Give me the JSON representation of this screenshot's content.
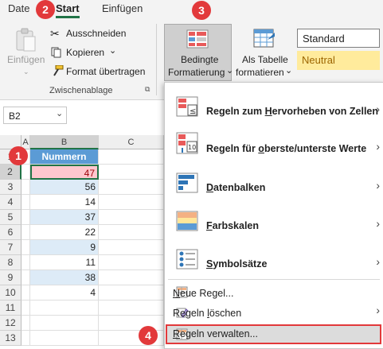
{
  "ribbon": {
    "tabs": [
      "Date",
      "Start",
      "Einfügen"
    ],
    "active_tab": "Start",
    "clipboard": {
      "paste_label": "Einfügen",
      "cut_label": "Ausschneiden",
      "copy_label": "Kopieren",
      "format_painter_label": "Format übertragen",
      "group_label": "Zwischenablage"
    },
    "conditional_formatting": {
      "line1": "Bedingte",
      "line2": "Formatierung"
    },
    "format_as_table": {
      "line1": "Als Tabelle",
      "line2": "formatieren"
    },
    "styles": [
      {
        "label": "Standard",
        "bg": "#ffffff"
      },
      {
        "label": "Neutral",
        "bg": "#ffeb9c",
        "color": "#9c6500"
      }
    ]
  },
  "badges": [
    "1",
    "2",
    "3",
    "4"
  ],
  "formula_bar": {
    "name_box": "B2"
  },
  "grid": {
    "columns": [
      "A",
      "B",
      "C"
    ],
    "rows": [
      "1",
      "2",
      "3",
      "4",
      "5",
      "6",
      "7",
      "8",
      "9",
      "10",
      "11",
      "12",
      "13"
    ],
    "header_cell": "Nummern",
    "values": [
      "47",
      "56",
      "14",
      "37",
      "22",
      "9",
      "11",
      "38",
      "4"
    ],
    "header_fill": "#5b9bd5",
    "highlight_fill": "#ffc7ce",
    "highlight_text": "#9c0006",
    "band_fill": "#ddebf7"
  },
  "menu": {
    "items": [
      {
        "pre": "Regeln zum ",
        "ul": "H",
        "post": "ervorheben von Zellen",
        "submenu": true
      },
      {
        "pre": "Regeln für ",
        "ul": "o",
        "post": "berste/unterste Werte",
        "submenu": true
      },
      {
        "pre": "",
        "ul": "D",
        "post": "atenbalken",
        "submenu": true
      },
      {
        "pre": "",
        "ul": "F",
        "post": "arbskalen",
        "submenu": true
      },
      {
        "pre": "",
        "ul": "S",
        "post": "ymbolsätze",
        "submenu": true
      }
    ],
    "small_items": [
      {
        "pre": "",
        "ul": "N",
        "post": "eue Regel..."
      },
      {
        "pre": "Regeln ",
        "ul": "l",
        "post": "öschen",
        "submenu": true
      },
      {
        "pre": "",
        "ul": "R",
        "post": "egeln verwalten..."
      }
    ]
  }
}
